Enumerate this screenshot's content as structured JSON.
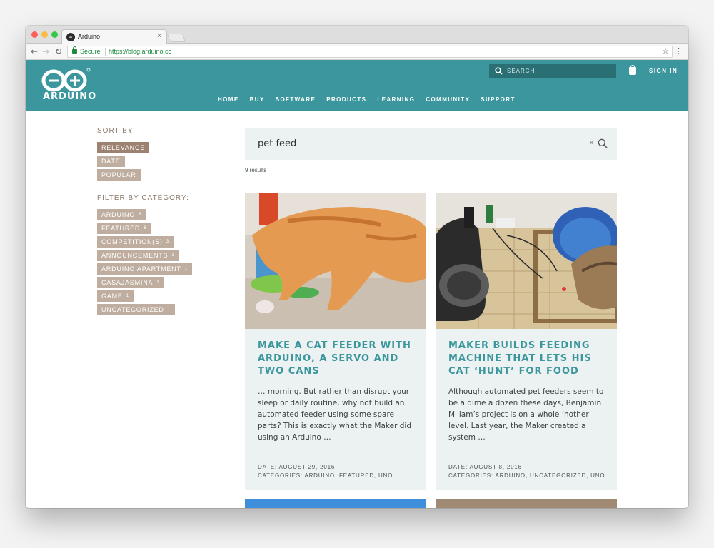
{
  "browser": {
    "tab_title": "Arduino",
    "tab_close": "×",
    "secure_label": "Secure",
    "url": "https://blog.arduino.cc"
  },
  "header": {
    "logo_text": "ARDUINO",
    "search_placeholder": "SEARCH",
    "sign_in": "SIGN IN",
    "nav": [
      "HOME",
      "BUY",
      "SOFTWARE",
      "PRODUCTS",
      "LEARNING",
      "COMMUNITY",
      "SUPPORT"
    ],
    "color": "#3b979d"
  },
  "sidebar": {
    "sort_heading": "SORT BY:",
    "sort_options": [
      "RELEVANCE",
      "DATE",
      "POPULAR"
    ],
    "active_sort": "RELEVANCE",
    "filter_heading": "FILTER BY CATEGORY:",
    "categories": [
      {
        "label": "ARDUINO",
        "count": "8"
      },
      {
        "label": "FEATURED",
        "count": "6"
      },
      {
        "label": "COMPETITION(S)",
        "count": "3"
      },
      {
        "label": "ANNOUNCEMENTS",
        "count": "1"
      },
      {
        "label": "ARDUINO APARTMENT",
        "count": "1"
      },
      {
        "label": "CASAJASMINA",
        "count": "1"
      },
      {
        "label": "GAME",
        "count": "1"
      },
      {
        "label": "UNCATEGORIZED",
        "count": "1"
      }
    ]
  },
  "search": {
    "query": "pet feed",
    "clear": "×",
    "results_count": "9 results"
  },
  "results": [
    {
      "title": "MAKE A CAT FEEDER WITH ARDUINO, A SERVO AND TWO CANS",
      "excerpt": "… morning. But rather than disrupt your sleep or daily routine, why not build an automated feeder using some spare parts? This is exactly what the Maker did using an Arduino …",
      "date": "DATE: AUGUST 29, 2016",
      "categories": "CATEGORIES: ARDUINO, FEATURED, UNO"
    },
    {
      "title": "MAKER BUILDS FEEDING MACHINE THAT LETS HIS CAT ‘HUNT’ FOR FOOD",
      "excerpt": "Although automated pet feeders seem to be a dime a dozen these days, Benjamin Millam’s project is on a whole ’nother level. Last year, the Maker created a system …",
      "date": "DATE: AUGUST 8, 2016",
      "categories": "CATEGORIES: ARDUINO, UNCATEGORIZED, UNO"
    }
  ]
}
